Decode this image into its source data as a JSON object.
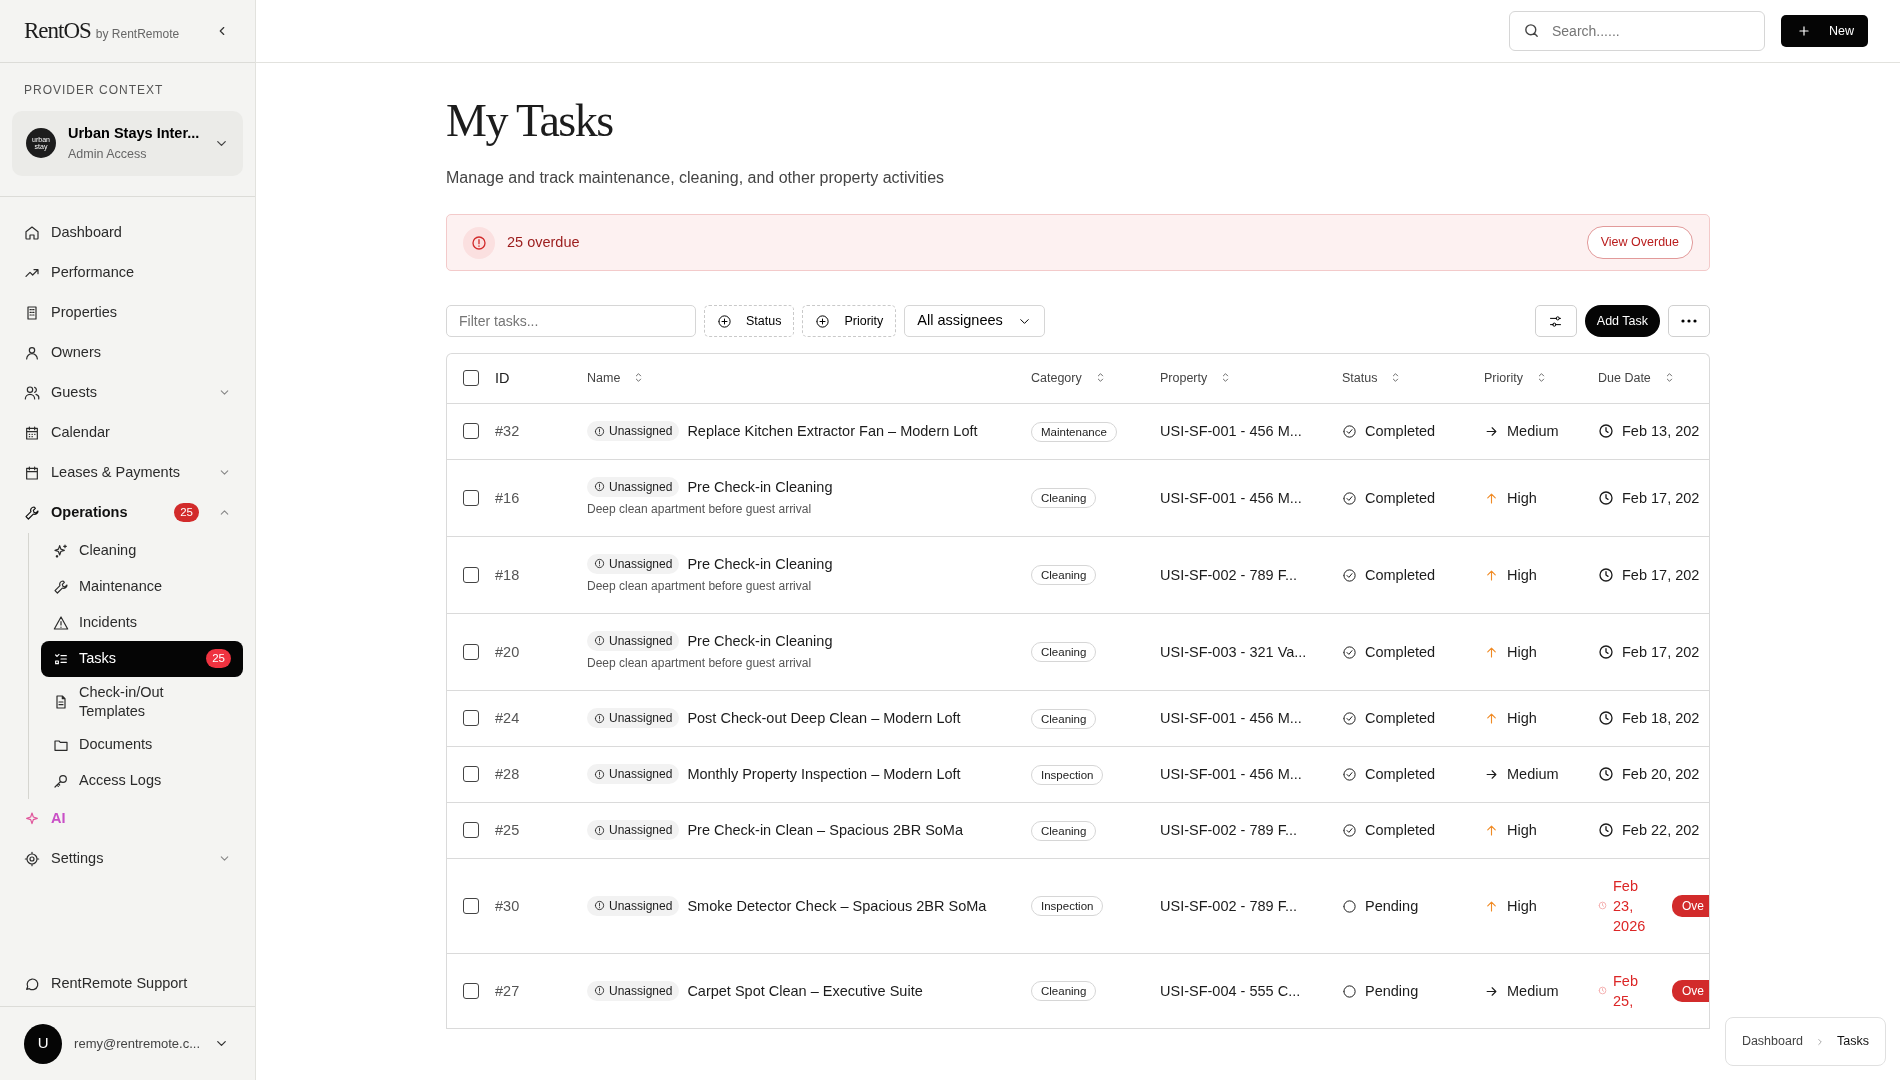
{
  "brand": {
    "name": "RentOS",
    "byline": "by RentRemote"
  },
  "sidebar": {
    "context_label": "PROVIDER CONTEXT",
    "provider": {
      "logo_text": "urban stay",
      "name": "Urban Stays Inter...",
      "role": "Admin Access"
    },
    "nav": [
      {
        "kind": "link",
        "label": "Dashboard",
        "selected": false
      },
      {
        "kind": "link",
        "label": "Performance",
        "selected": false
      },
      {
        "kind": "link",
        "label": "Properties",
        "selected": false
      },
      {
        "kind": "link",
        "label": "Owners",
        "selected": false
      },
      {
        "kind": "link",
        "label": "Guests",
        "selected": false,
        "expanded": false
      },
      {
        "kind": "link",
        "label": "Calendar",
        "selected": false
      },
      {
        "kind": "link",
        "label": "Leases & Payments",
        "selected": false,
        "expanded": false
      },
      {
        "kind": "link",
        "label": "Operations",
        "selected": false,
        "badge": "25",
        "expanded": true,
        "children": [
          {
            "label": "Cleaning",
            "selected": false
          },
          {
            "label": "Maintenance",
            "selected": false
          },
          {
            "label": "Incidents",
            "selected": false
          },
          {
            "label": "Tasks",
            "selected": true,
            "badge": "25"
          },
          {
            "label": "Check-in/Out Templates",
            "selected": false
          },
          {
            "label": "Documents",
            "selected": false
          },
          {
            "label": "Access Logs",
            "selected": false
          }
        ]
      },
      {
        "kind": "ai",
        "label": "AI",
        "selected": false
      },
      {
        "kind": "link",
        "label": "Settings",
        "selected": false,
        "expanded": false
      }
    ],
    "support": "RentRemote Support",
    "user": {
      "initial": "U",
      "email": "remy@rentremote.c..."
    }
  },
  "header": {
    "search_placeholder": "Search......",
    "new_button": "New"
  },
  "page": {
    "title": "My Tasks",
    "subtitle": "Manage and track maintenance, cleaning, and other property activities"
  },
  "alert": {
    "text": "25 overdue",
    "button": "View Overdue"
  },
  "toolbar": {
    "filter_placeholder": "Filter tasks...",
    "filters": [
      "Status",
      "Priority"
    ],
    "assignee": "All assignees",
    "add_button": "Add Task"
  },
  "table": {
    "select_all_checked": false,
    "columns": [
      {
        "label": "ID",
        "sortable": false
      },
      {
        "label": "Name",
        "sortable": true
      },
      {
        "label": "Category",
        "sortable": true
      },
      {
        "label": "Property",
        "sortable": true
      },
      {
        "label": "Status",
        "sortable": true
      },
      {
        "label": "Priority",
        "sortable": true
      },
      {
        "label": "Due Date",
        "sortable": true
      }
    ],
    "rows": [
      {
        "checked": false,
        "id": "#32",
        "assignee": "Unassigned",
        "name": "Replace Kitchen Extractor Fan – Modern Loft",
        "category": "Maintenance",
        "property": "USI-SF-001 - 456 M...",
        "status": {
          "text": "Completed",
          "kind": "completed"
        },
        "priority": {
          "text": "Medium",
          "kind": "medium"
        },
        "due": "Feb 13, 202",
        "overdue": false
      },
      {
        "checked": false,
        "id": "#16",
        "assignee": "Unassigned",
        "name": "Pre Check-in Cleaning",
        "description": "Deep clean apartment before guest arrival",
        "category": "Cleaning",
        "property": "USI-SF-001 - 456 M...",
        "status": {
          "text": "Completed",
          "kind": "completed"
        },
        "priority": {
          "text": "High",
          "kind": "high"
        },
        "due": "Feb 17, 202",
        "overdue": false
      },
      {
        "checked": false,
        "id": "#18",
        "assignee": "Unassigned",
        "name": "Pre Check-in Cleaning",
        "description": "Deep clean apartment before guest arrival",
        "category": "Cleaning",
        "property": "USI-SF-002 - 789 F...",
        "status": {
          "text": "Completed",
          "kind": "completed"
        },
        "priority": {
          "text": "High",
          "kind": "high"
        },
        "due": "Feb 17, 202",
        "overdue": false
      },
      {
        "checked": false,
        "id": "#20",
        "assignee": "Unassigned",
        "name": "Pre Check-in Cleaning",
        "description": "Deep clean apartment before guest arrival",
        "category": "Cleaning",
        "property": "USI-SF-003 - 321 Va...",
        "status": {
          "text": "Completed",
          "kind": "completed"
        },
        "priority": {
          "text": "High",
          "kind": "high"
        },
        "due": "Feb 17, 202",
        "overdue": false
      },
      {
        "checked": false,
        "id": "#24",
        "assignee": "Unassigned",
        "name": "Post Check-out Deep Clean – Modern Loft",
        "category": "Cleaning",
        "property": "USI-SF-001 - 456 M...",
        "status": {
          "text": "Completed",
          "kind": "completed"
        },
        "priority": {
          "text": "High",
          "kind": "high"
        },
        "due": "Feb 18, 202",
        "overdue": false
      },
      {
        "checked": false,
        "id": "#28",
        "assignee": "Unassigned",
        "name": "Monthly Property Inspection – Modern Loft",
        "category": "Inspection",
        "property": "USI-SF-001 - 456 M...",
        "status": {
          "text": "Completed",
          "kind": "completed"
        },
        "priority": {
          "text": "Medium",
          "kind": "medium"
        },
        "due": "Feb 20, 202",
        "overdue": false
      },
      {
        "checked": false,
        "id": "#25",
        "assignee": "Unassigned",
        "name": "Pre Check-in Clean – Spacious 2BR SoMa",
        "category": "Cleaning",
        "property": "USI-SF-002 - 789 F...",
        "status": {
          "text": "Completed",
          "kind": "completed"
        },
        "priority": {
          "text": "High",
          "kind": "high"
        },
        "due": "Feb 22, 202",
        "overdue": false
      },
      {
        "checked": false,
        "id": "#30",
        "assignee": "Unassigned",
        "name": "Smoke Detector Check – Spacious 2BR SoMa",
        "category": "Inspection",
        "property": "USI-SF-002 - 789 F...",
        "status": {
          "text": "Pending",
          "kind": "pending"
        },
        "priority": {
          "text": "High",
          "kind": "high"
        },
        "due": "Feb 23, 2026",
        "overdue": true,
        "overdue_badge": "Ove"
      },
      {
        "checked": false,
        "id": "#27",
        "assignee": "Unassigned",
        "name": "Carpet Spot Clean – Executive Suite",
        "category": "Cleaning",
        "property": "USI-SF-004 - 555 C...",
        "status": {
          "text": "Pending",
          "kind": "pending"
        },
        "priority": {
          "text": "Medium",
          "kind": "medium"
        },
        "due": "Feb 25,",
        "overdue": true,
        "overdue_badge": "Ove"
      }
    ]
  },
  "breadcrumb": [
    {
      "label": "Dashboard",
      "current": false
    },
    {
      "label": "Tasks",
      "current": true
    }
  ]
}
